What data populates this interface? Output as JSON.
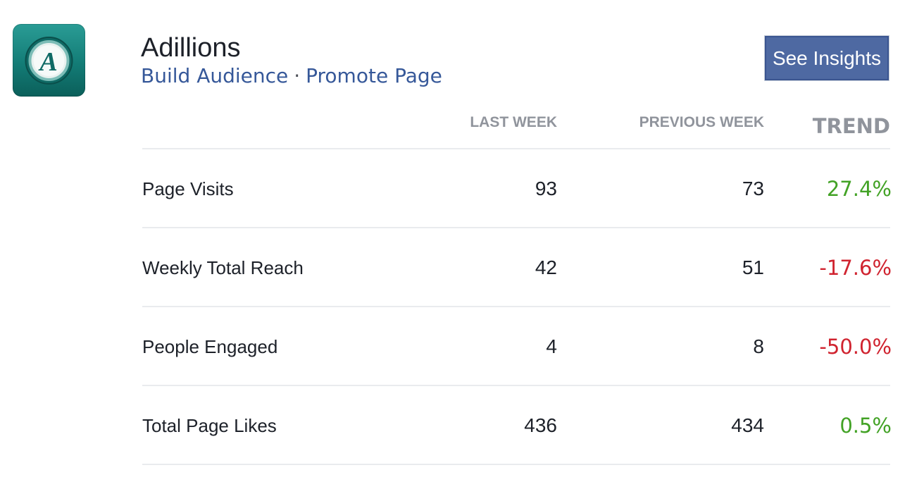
{
  "page": {
    "icon": "page-logo-icon",
    "icon_letter": "A",
    "name": "Adillions",
    "links": [
      "Build Audience",
      "Promote Page"
    ],
    "separator": "·",
    "insights_button": "See Insights"
  },
  "table": {
    "headers": {
      "last_week": "LAST WEEK",
      "previous_week": "PREVIOUS WEEK",
      "trend": "TREND"
    },
    "rows": [
      {
        "label": "Page Visits",
        "last_week": "93",
        "previous_week": "73",
        "trend": "27.4%",
        "direction": "up"
      },
      {
        "label": "Weekly Total Reach",
        "last_week": "42",
        "previous_week": "51",
        "trend": "-17.6%",
        "direction": "down"
      },
      {
        "label": "People Engaged",
        "last_week": "4",
        "previous_week": "8",
        "trend": "-50.0%",
        "direction": "down"
      },
      {
        "label": "Total Page Likes",
        "last_week": "436",
        "previous_week": "434",
        "trend": "0.5%",
        "direction": "up"
      }
    ]
  },
  "colors": {
    "link": "#365899",
    "button_bg": "#4e69a2",
    "trend_up": "#42a225",
    "trend_down": "#d0232f",
    "header_text": "#90949c",
    "icon_bg": "#137c76"
  }
}
